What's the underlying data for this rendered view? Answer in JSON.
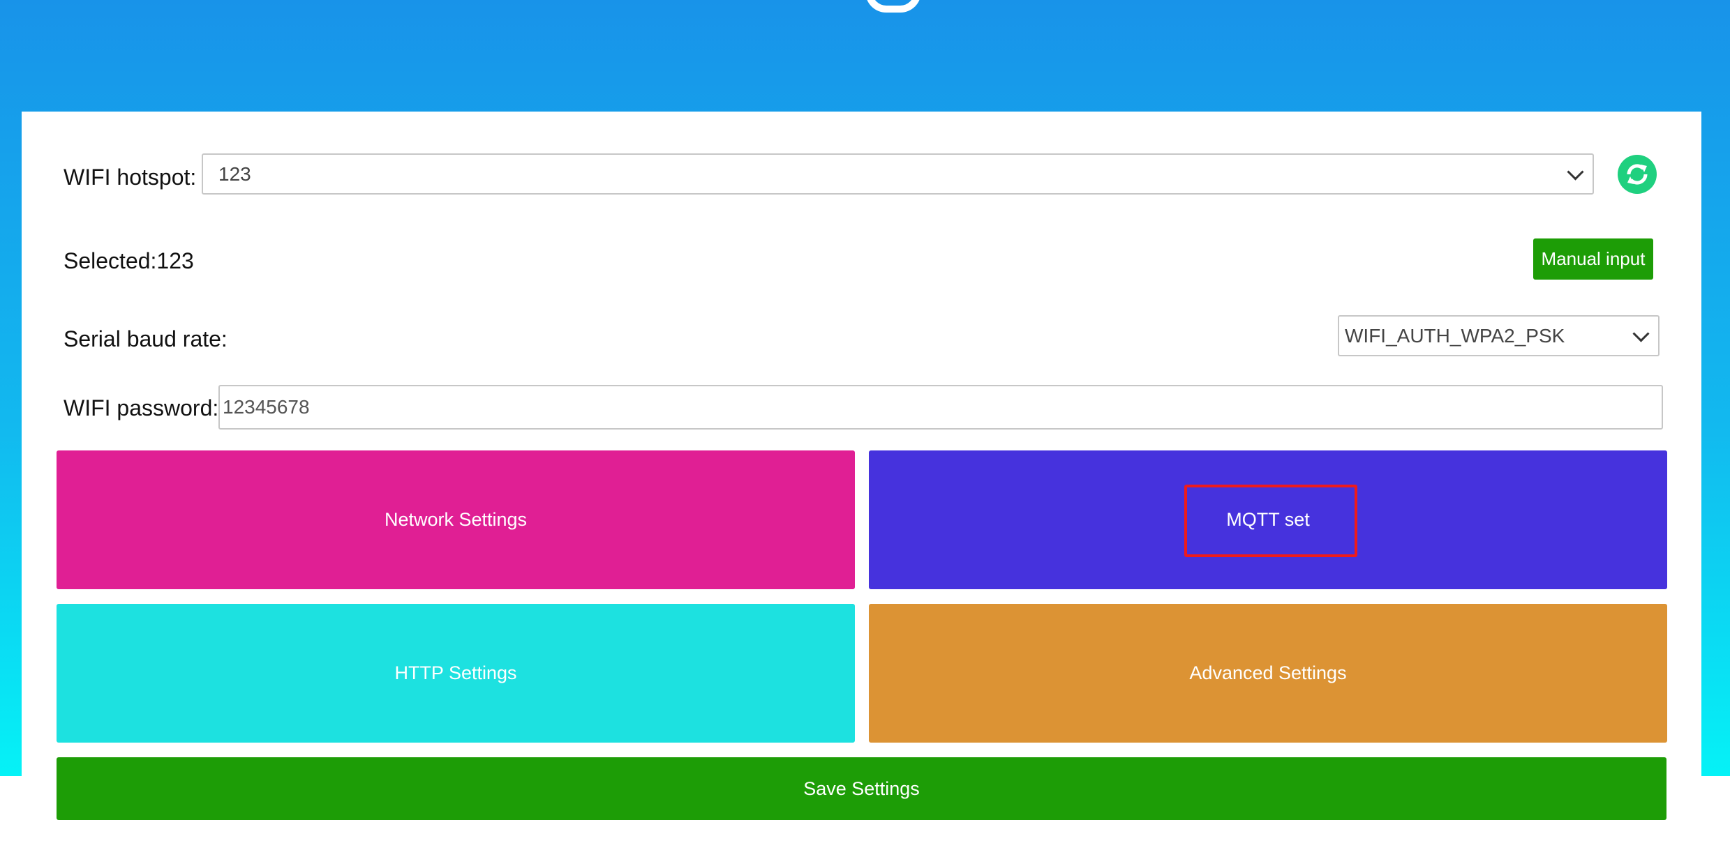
{
  "form": {
    "wifi_hotspot_label": "WIFI hotspot:",
    "wifi_hotspot_value": "123",
    "selected_text": "Selected:123",
    "manual_input_label": "Manual input",
    "baud_rate_label": "Serial baud rate:",
    "auth_mode_value": "WIFI_AUTH_WPA2_PSK",
    "wifi_password_label": "WIFI password:",
    "wifi_password_value": "12345678"
  },
  "tiles": {
    "network": "Network Settings",
    "mqtt": "MQTT set",
    "http": "HTTP Settings",
    "advanced": "Advanced Settings"
  },
  "save_label": "Save Settings",
  "icons": {
    "refresh": "refresh-icon",
    "dropdown": "chevron-down-icon"
  },
  "colors": {
    "header_gradient_top": "#1893e9",
    "header_gradient_bottom": "#05f2f6",
    "network_tile": "#e01f94",
    "mqtt_tile": "#4632dd",
    "http_tile": "#1de1e0",
    "advanced_tile": "#dc9334",
    "save_button": "#1d9d06",
    "manual_button": "#1d9d06",
    "refresh_icon": "#1fd07f",
    "highlight_box": "#ef1b1b"
  }
}
